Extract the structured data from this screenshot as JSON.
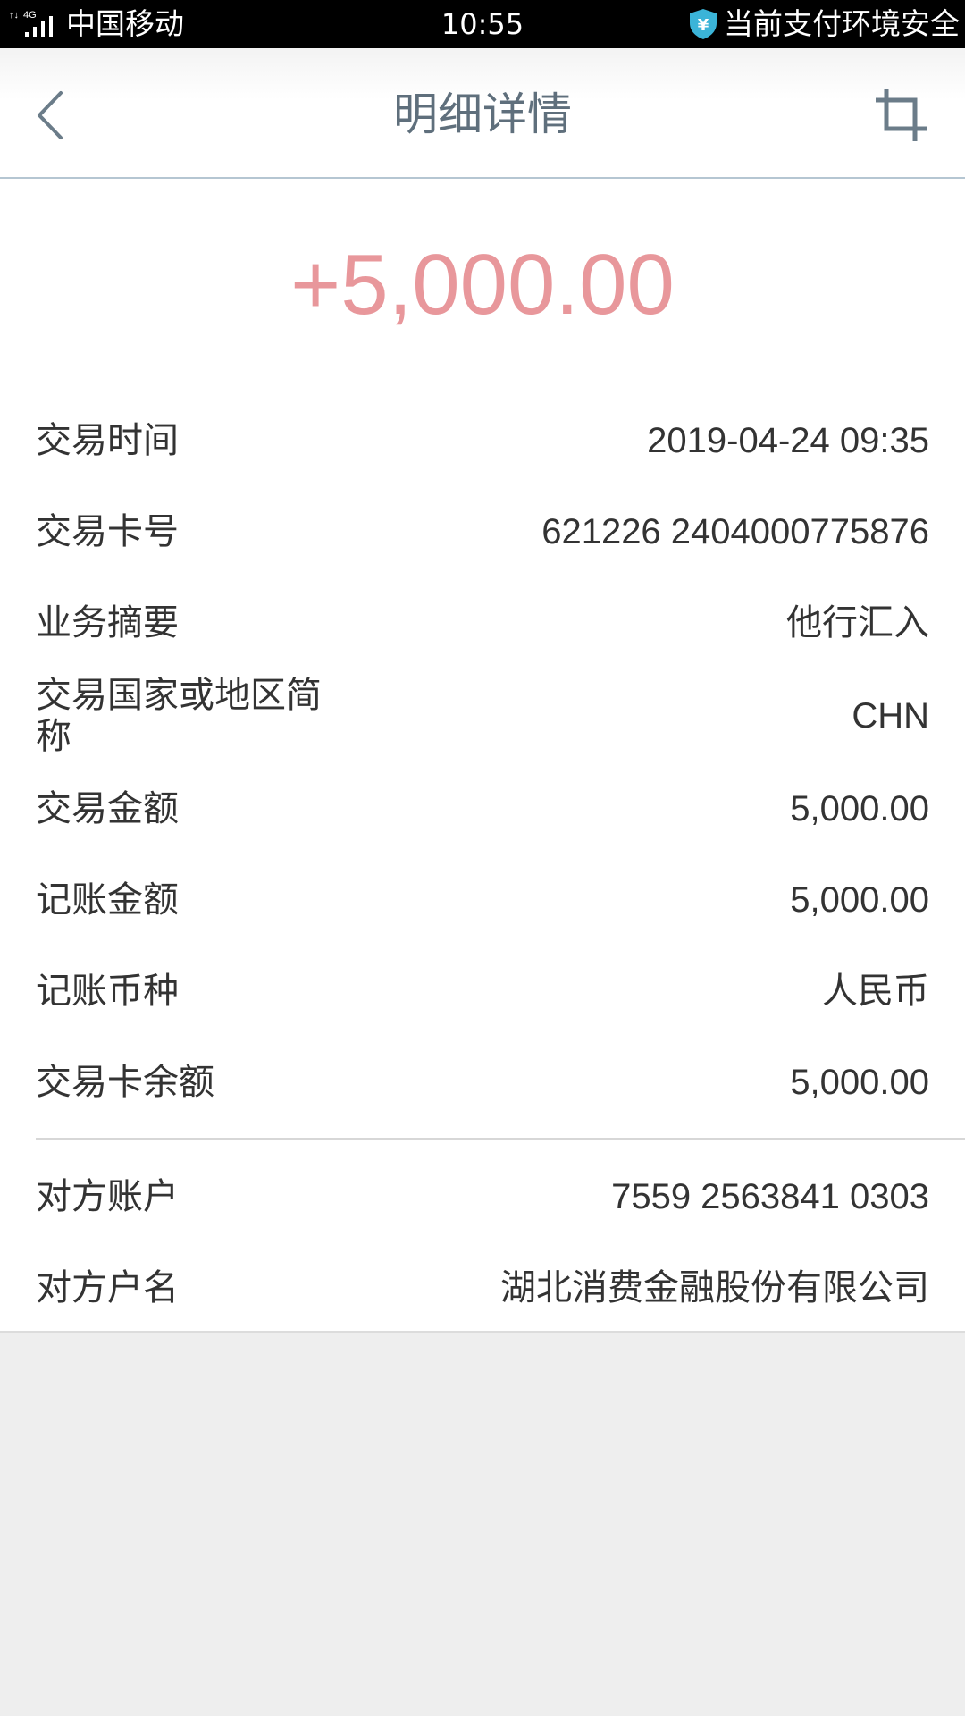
{
  "status_bar": {
    "carrier": "中国移动",
    "network": "4G",
    "time": "10:55",
    "security_text": "当前支付环境安全",
    "security_icon": "shield-yuan-icon"
  },
  "header": {
    "title": "明细详情",
    "back_icon": "chevron-left-icon",
    "crop_icon": "crop-icon"
  },
  "transaction": {
    "amount": "+5,000.00",
    "amount_color": "#e8979b"
  },
  "details": [
    {
      "label": "交易时间",
      "value": "2019-04-24 09:35"
    },
    {
      "label": "交易卡号",
      "value": "621226 2404000775876"
    },
    {
      "label": "业务摘要",
      "value": "他行汇入"
    },
    {
      "label": "交易国家或地区简称",
      "value": "CHN"
    },
    {
      "label": "交易金额",
      "value": "5,000.00"
    },
    {
      "label": "记账金额",
      "value": "5,000.00"
    },
    {
      "label": "记账币种",
      "value": "人民币"
    },
    {
      "label": "交易卡余额",
      "value": "5,000.00"
    }
  ],
  "counterparty": [
    {
      "label": "对方账户",
      "value": "7559 2563841 0303"
    },
    {
      "label": "对方户名",
      "value": "湖北消费金融股份有限公司"
    }
  ]
}
